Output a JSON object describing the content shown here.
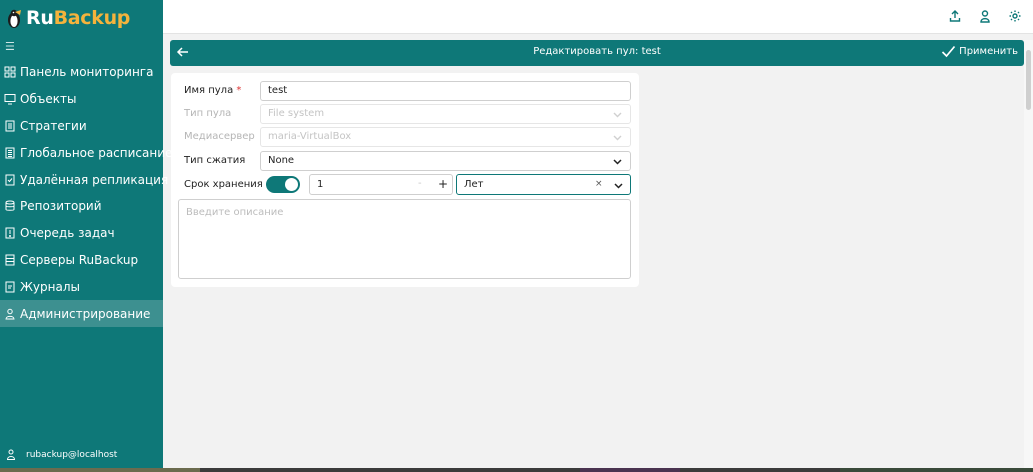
{
  "brand": {
    "name_part1": "Ru",
    "name_part2": "Backup",
    "accent": "#0e7878",
    "logo_yellow": "#f4b33c"
  },
  "sidebar": {
    "collapse_glyph": "☰",
    "items": [
      {
        "label": "Панель мониторинга",
        "icon": "dashboard-icon"
      },
      {
        "label": "Объекты",
        "icon": "monitor-icon"
      },
      {
        "label": "Стратегии",
        "icon": "document-icon"
      },
      {
        "label": "Глобальное расписание",
        "icon": "calendar-icon"
      },
      {
        "label": "Удалённая репликация",
        "icon": "replication-icon"
      },
      {
        "label": "Репозиторий",
        "icon": "database-icon"
      },
      {
        "label": "Очередь задач",
        "icon": "task-queue-icon"
      },
      {
        "label": "Серверы RuBackup",
        "icon": "server-icon"
      },
      {
        "label": "Журналы",
        "icon": "log-icon"
      },
      {
        "label": "Администрирование",
        "icon": "user-admin-icon",
        "active": true
      }
    ],
    "user": "rubackup@localhost"
  },
  "header": {
    "icons": [
      "upload-icon",
      "user-icon",
      "settings-icon"
    ]
  },
  "page": {
    "title": "Редактировать пул: test",
    "apply_label": "Применить"
  },
  "form": {
    "pool_name": {
      "label": "Имя пула",
      "required_mark": "*",
      "value": "test"
    },
    "pool_type": {
      "label": "Тип пула",
      "value": "File system",
      "disabled": true
    },
    "media_server": {
      "label": "Медиасервер",
      "value": "maria-VirtualBox",
      "disabled": true
    },
    "compression": {
      "label": "Тип сжатия",
      "value": "None"
    },
    "retention": {
      "label": "Срок хранения",
      "enabled": true,
      "value": "1",
      "minus": "-",
      "plus": "+",
      "unit": "Лет",
      "clear": "×"
    },
    "description": {
      "placeholder": "Введите описание",
      "value": ""
    }
  }
}
